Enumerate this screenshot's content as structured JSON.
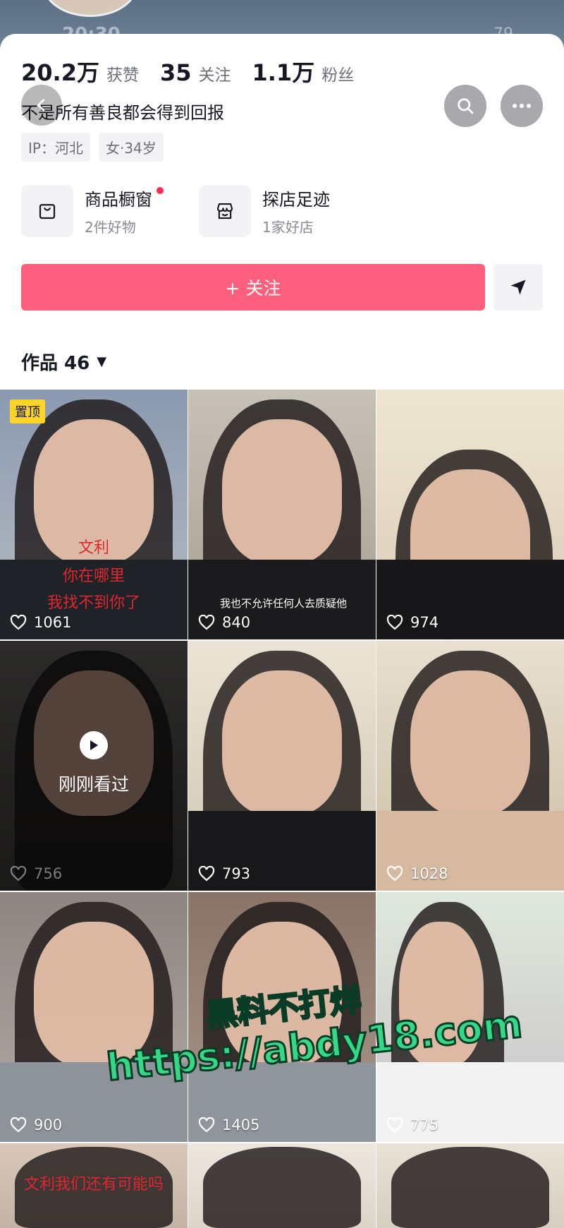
{
  "status_bar": {
    "time": "20:30",
    "battery": "79"
  },
  "profile": {
    "stats": [
      {
        "value": "20.2万",
        "label": "获赞"
      },
      {
        "value": "35",
        "label": "关注"
      },
      {
        "value": "1.1万",
        "label": "粉丝"
      }
    ],
    "bio": "不是所有善良都会得到回报",
    "tags": [
      "IP：河北",
      "女·34岁"
    ],
    "entries": [
      {
        "title": "商品橱窗",
        "subtitle": "2件好物"
      },
      {
        "title": "探店足迹",
        "subtitle": "1家好店"
      }
    ],
    "follow_label": "+ 关注"
  },
  "works_tab": {
    "label": "作品 46",
    "caret": "▼"
  },
  "videos": [
    {
      "likes": "1061",
      "pinned_label": "置顶",
      "caption_lines": [
        "文利",
        "你在哪里",
        "我找不到你了"
      ]
    },
    {
      "likes": "840",
      "caption": "我也不允许任何人去质疑他"
    },
    {
      "likes": "974"
    },
    {
      "likes": "756",
      "watched_label": "刚刚看过"
    },
    {
      "likes": "793"
    },
    {
      "likes": "1028"
    },
    {
      "likes": "900"
    },
    {
      "likes": "1405"
    },
    {
      "likes": "775"
    },
    {
      "caption": "文利我们还有可能吗"
    },
    {},
    {}
  ],
  "watermark": {
    "line1": "黑料不打烊",
    "line2": "https://abdy18.com"
  }
}
